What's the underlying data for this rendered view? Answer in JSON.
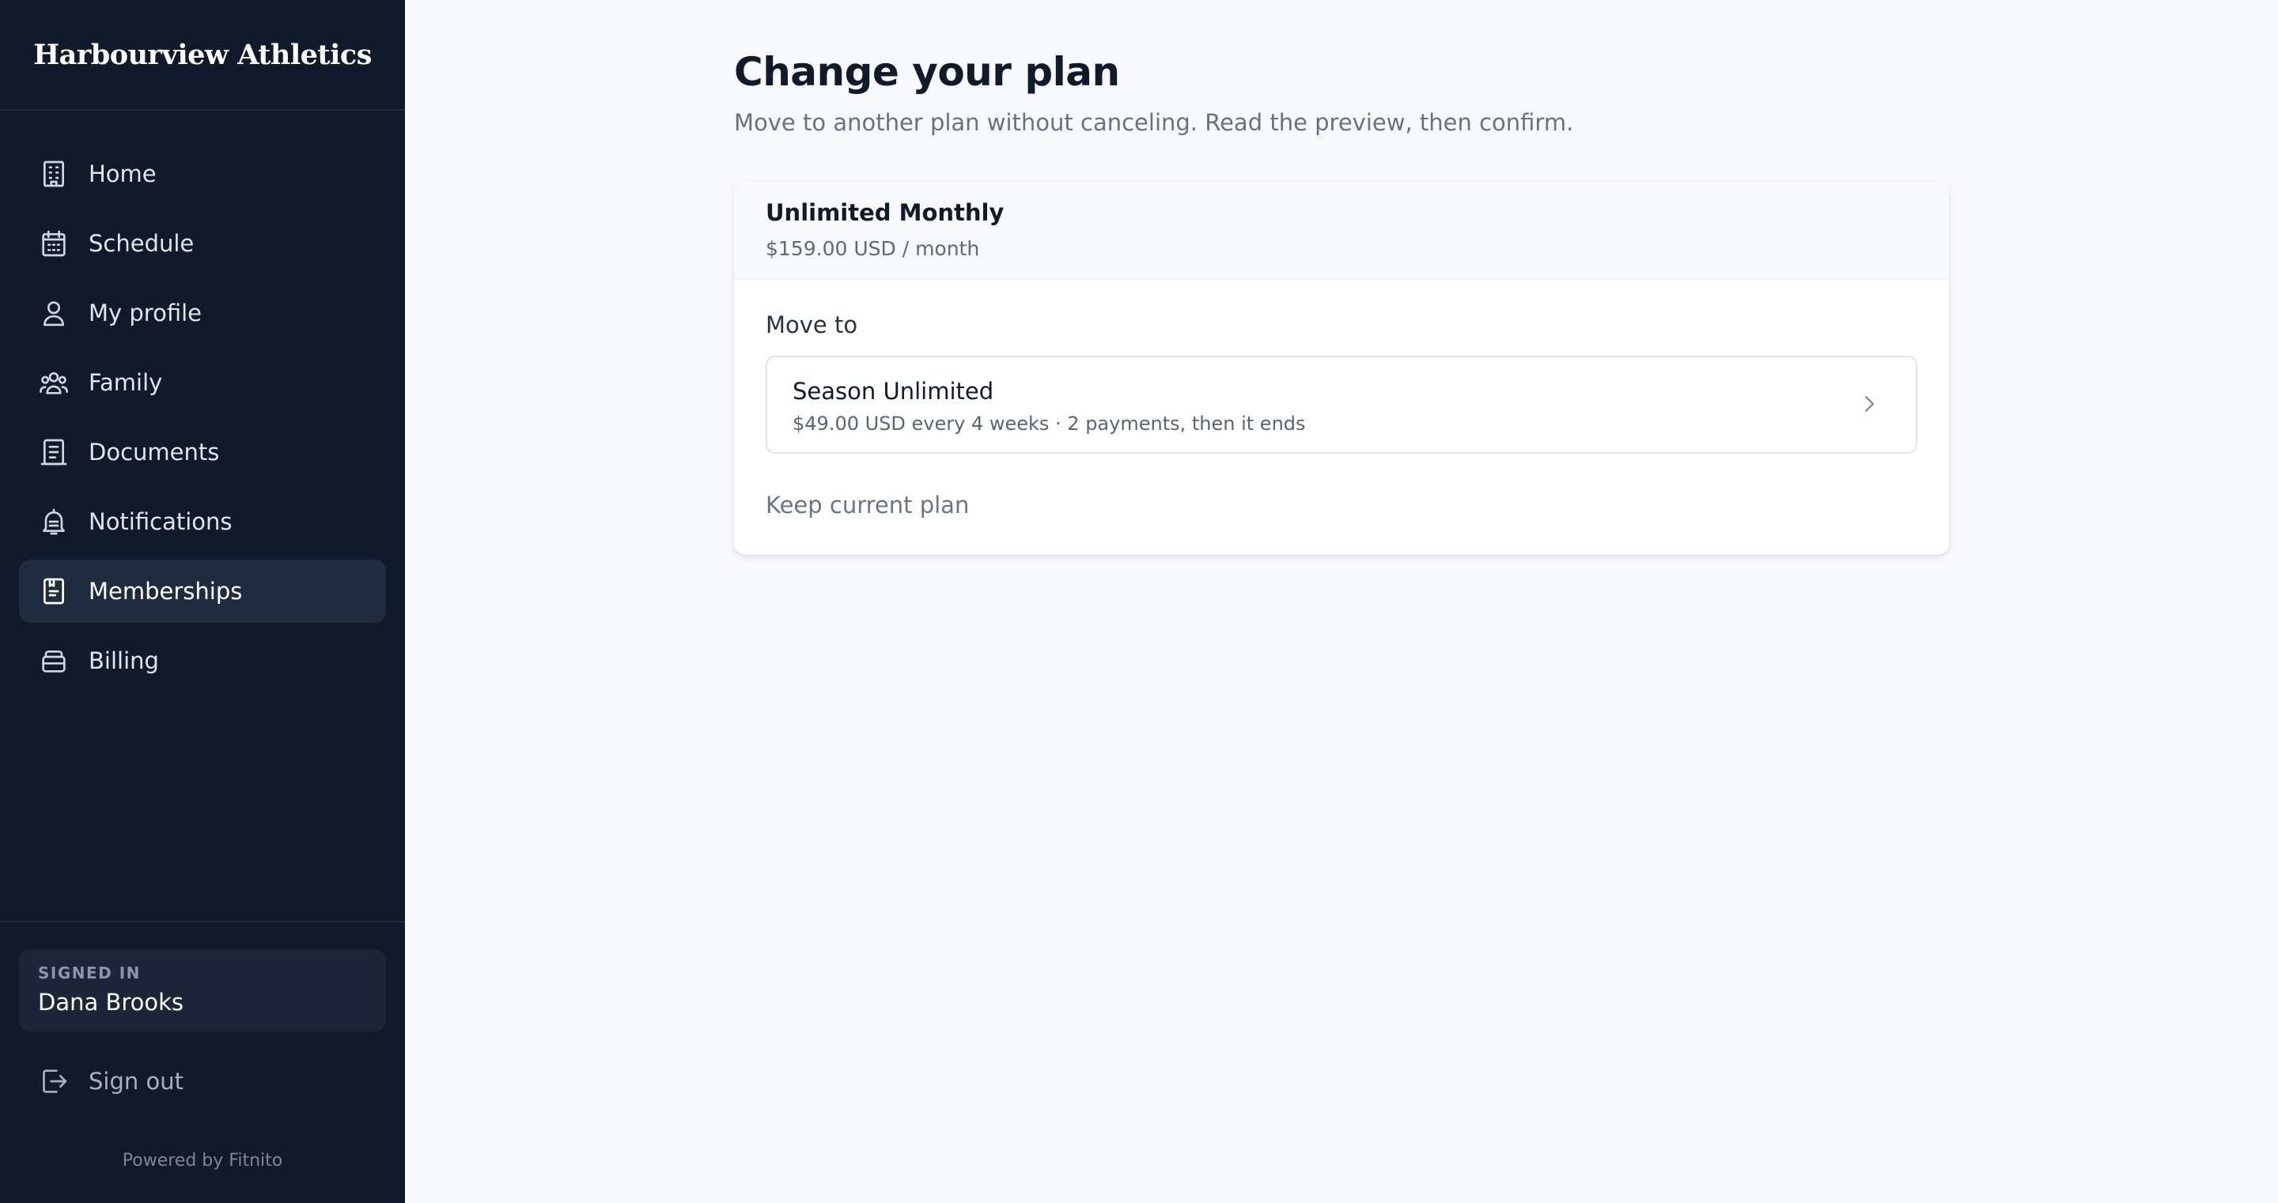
{
  "brand": {
    "name": "Harbourview Athletics"
  },
  "sidebar": {
    "items": [
      {
        "label": "Home",
        "icon": "building-icon",
        "active": false
      },
      {
        "label": "Schedule",
        "icon": "calendar-icon",
        "active": false
      },
      {
        "label": "My profile",
        "icon": "user-icon",
        "active": false
      },
      {
        "label": "Family",
        "icon": "users-icon",
        "active": false
      },
      {
        "label": "Documents",
        "icon": "document-icon",
        "active": false
      },
      {
        "label": "Notifications",
        "icon": "bell-icon",
        "active": false
      },
      {
        "label": "Memberships",
        "icon": "clipboard-icon",
        "active": true
      },
      {
        "label": "Billing",
        "icon": "wallet-icon",
        "active": false
      }
    ],
    "signed_in_label": "SIGNED IN",
    "user_name": "Dana Brooks",
    "signout_label": "Sign out",
    "powered_by": "Powered by Fitnito"
  },
  "main": {
    "title": "Change your plan",
    "subtitle": "Move to another plan without canceling. Read the preview, then confirm.",
    "current_plan": {
      "name": "Unlimited Monthly",
      "price": "$159.00 USD / month"
    },
    "move_to_label": "Move to",
    "options": [
      {
        "name": "Season Unlimited",
        "detail": "$49.00 USD every 4 weeks · 2 payments, then it ends"
      }
    ],
    "keep_label": "Keep current plan"
  },
  "colors": {
    "sidebar_bg": "#111a2b",
    "active_item_bg": "#1f2b3e",
    "page_bg": "#f8f9fb",
    "title_text": "#111a2b"
  }
}
